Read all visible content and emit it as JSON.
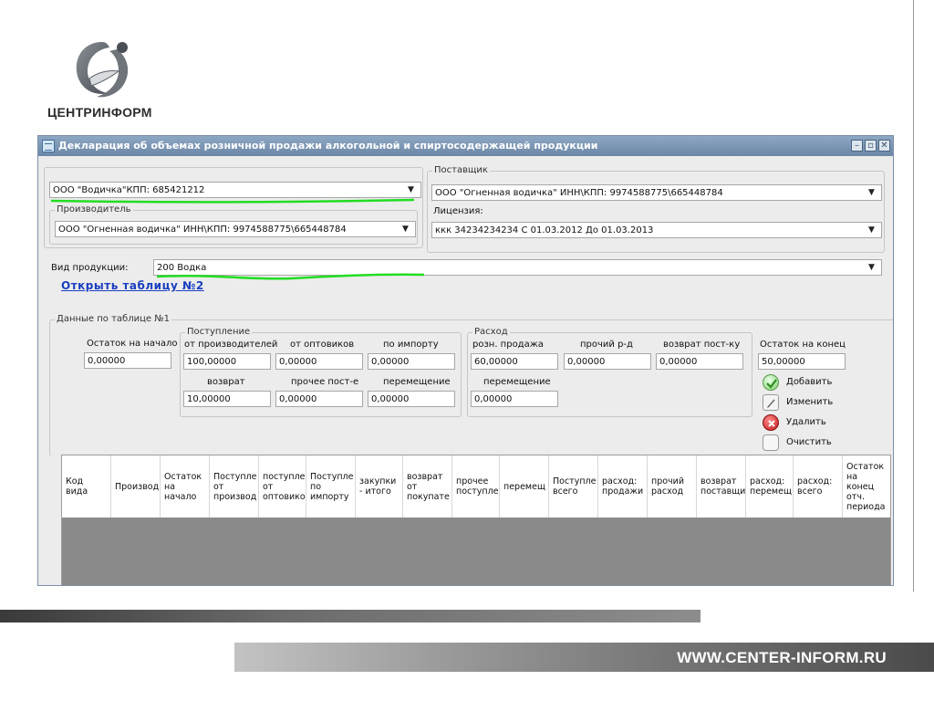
{
  "brand": {
    "name": "ЦЕНТРИНФОРМ",
    "logo_icon": "centrinform-logo-icon"
  },
  "window": {
    "title": "Декларация об объемах розничной продажи алкогольной и спиртосодержащей продукции",
    "buttons": [
      "minimize-icon",
      "restore-icon",
      "close-icon"
    ]
  },
  "form": {
    "organization": "ООО \"Водичка\"КПП: 685421212",
    "manufacturer_group": "Производитель",
    "manufacturer": "ООО \"Огненная водичка\"  ИНН\\КПП: 9974588775\\665448784",
    "supplier_group": "Поставщик",
    "supplier": "ООО \"Огненная водичка\"  ИНН\\КПП:  9974588775\\665448784",
    "license_label": "Лицензия:",
    "license": "ккк  34234234234 С 01.03.2012 До 01.03.2013",
    "product_type_label": "Вид продукции:",
    "product_type": "200 Водка",
    "open_table_link": "Открыть таблицу №2"
  },
  "table1": {
    "group": "Данные по таблице №1",
    "opening_label": "Остаток на начало",
    "opening_value": "0,00000",
    "receipt": {
      "group": "Поступление",
      "from_producers_label": "от производителей",
      "from_producers_value": "100,00000",
      "from_wholesalers_label": "от оптовиков",
      "from_wholesalers_value": "0,00000",
      "import_label": "по импорту",
      "import_value": "0,00000",
      "return_label": "возврат",
      "return_value": "10,00000",
      "other_label": "прочее пост-е",
      "other_value": "0,00000",
      "transfer_label": "перемещение",
      "transfer_value": "0,00000"
    },
    "expense": {
      "group": "Расход",
      "retail_label": "розн. продажа",
      "retail_value": "60,00000",
      "other_label": "прочий р-д",
      "other_value": "0,00000",
      "return_label": "возврат пост-ку",
      "return_value": "0,00000",
      "transfer_label": "перемещение",
      "transfer_value": "0,00000"
    },
    "closing_label": "Остаток на конец",
    "closing_value": "50,00000"
  },
  "actions": {
    "add": "Добавить",
    "edit": "Изменить",
    "delete": "Удалить",
    "clear": "Очистить"
  },
  "grid_headers": [
    "Код\nвида",
    "Производ",
    "Остаток\nна\nначало",
    "Поступле\nот\nпроизвод",
    "поступле\nот\nоптовико",
    "Поступле\nпо\nимпорту",
    "закупки\n- итого",
    "возврат\nот\nпокупате",
    "прочее\nпоступлен",
    "перемещ",
    "Поступле\nвсего",
    "расход:\nпродажи",
    "прочий\nрасход",
    "возврат\nпоставщи",
    "расход:\nперемещ",
    "расход:\nвсего",
    "Остаток\nна\nконец\nотч.\nпериода"
  ],
  "footer": {
    "site": "WWW.CENTER-INFORM.RU"
  },
  "colors": {
    "underline": "#22dd22",
    "link": "#1a3fbf",
    "titlebar": "#7a93b2"
  }
}
